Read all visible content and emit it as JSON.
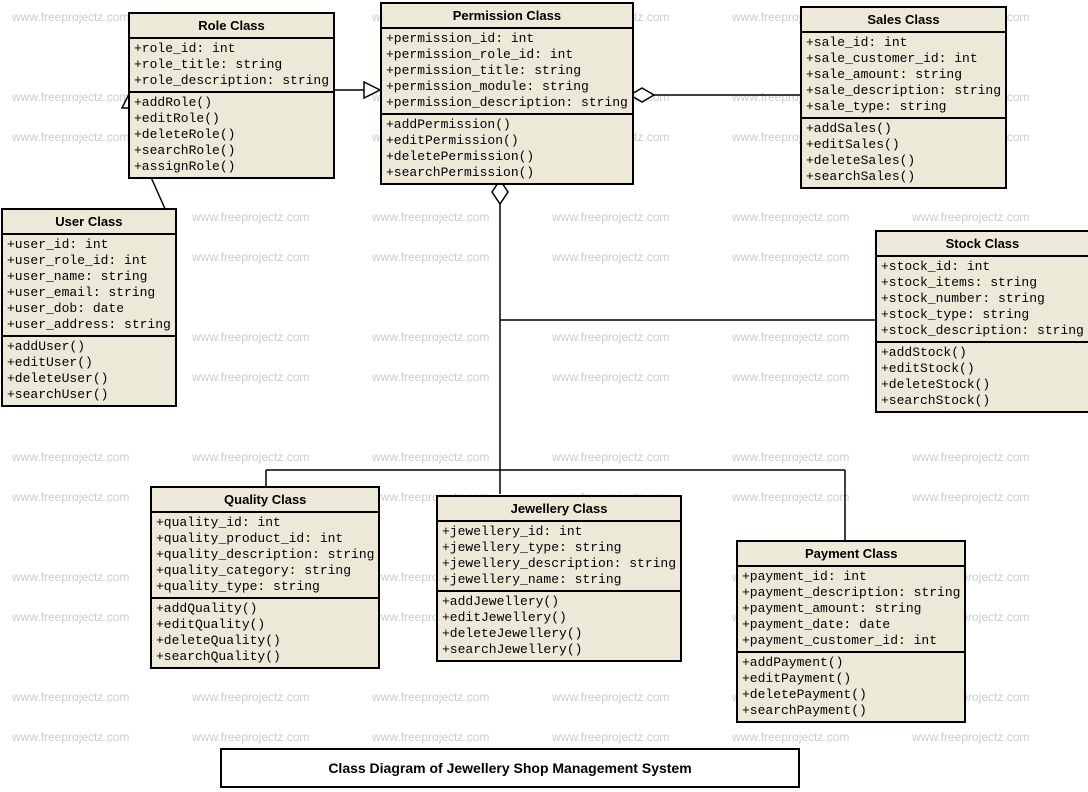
{
  "watermark": "www.freeprojectz.com",
  "caption": "Class Diagram of Jewellery Shop Management System",
  "role": {
    "title": "Role Class",
    "attrs": [
      "+role_id: int",
      "+role_title: string",
      "+role_description: string"
    ],
    "ops": [
      "+addRole()",
      "+editRole()",
      "+deleteRole()",
      "+searchRole()",
      "+assignRole()"
    ]
  },
  "permission": {
    "title": "Permission Class",
    "attrs": [
      "+permission_id: int",
      "+permission_role_id: int",
      "+permission_title: string",
      "+permission_module: string",
      "+permission_description: string"
    ],
    "ops": [
      "+addPermission()",
      "+editPermission()",
      "+deletePermission()",
      "+searchPermission()"
    ]
  },
  "sales": {
    "title": "Sales Class",
    "attrs": [
      "+sale_id: int",
      "+sale_customer_id: int",
      "+sale_amount: string",
      "+sale_description: string",
      "+sale_type: string"
    ],
    "ops": [
      "+addSales()",
      "+editSales()",
      "+deleteSales()",
      "+searchSales()"
    ]
  },
  "user": {
    "title": "User Class",
    "attrs": [
      "+user_id: int",
      "+user_role_id: int",
      "+user_name: string",
      "+user_email: string",
      "+user_dob: date",
      "+user_address: string"
    ],
    "ops": [
      "+addUser()",
      "+editUser()",
      "+deleteUser()",
      "+searchUser()"
    ]
  },
  "stock": {
    "title": "Stock Class",
    "attrs": [
      "+stock_id: int",
      "+stock_items: string",
      "+stock_number: string",
      "+stock_type: string",
      "+stock_description: string"
    ],
    "ops": [
      "+addStock()",
      "+editStock()",
      "+deleteStock()",
      "+searchStock()"
    ]
  },
  "quality": {
    "title": "Quality Class",
    "attrs": [
      "+quality_id: int",
      "+quality_product_id: int",
      "+quality_description: string",
      "+quality_category: string",
      "+quality_type: string"
    ],
    "ops": [
      "+addQuality()",
      "+editQuality()",
      "+deleteQuality()",
      "+searchQuality()"
    ]
  },
  "jewellery": {
    "title": "Jewellery Class",
    "attrs": [
      "+jewellery_id: int",
      "+jewellery_type: string",
      "+jewellery_description: string",
      "+jewellery_name: string"
    ],
    "ops": [
      "+addJewellery()",
      "+editJewellery()",
      "+deleteJewellery()",
      "+searchJewellery()"
    ]
  },
  "payment": {
    "title": "Payment Class",
    "attrs": [
      "+payment_id: int",
      "+payment_description: string",
      "+payment_amount: string",
      "+payment_date: date",
      "+payment_customer_id: int"
    ],
    "ops": [
      "+addPayment()",
      "+editPayment()",
      "+deletePayment()",
      "+searchPayment()"
    ]
  }
}
